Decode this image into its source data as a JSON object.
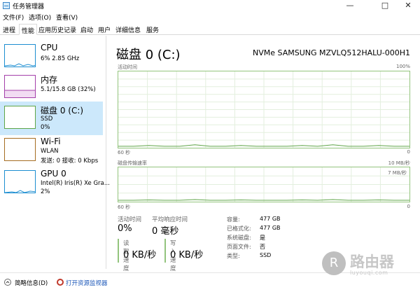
{
  "window": {
    "title": "任务管理器",
    "controls": [
      "—",
      "□",
      "✕"
    ]
  },
  "menu": [
    "文件(F)",
    "选项(O)",
    "查看(V)"
  ],
  "tabs": [
    "进程",
    "性能",
    "应用历史记录",
    "启动",
    "用户",
    "详细信息",
    "服务"
  ],
  "active_tab": "性能",
  "sidebar": [
    {
      "name": "CPU",
      "line1": "6%  2.85 GHz",
      "line2": "",
      "color": "#1d8ed1"
    },
    {
      "name": "内存",
      "line1": "5.1/15.8 GB (32%)",
      "line2": "",
      "color": "#a43faa"
    },
    {
      "name": "磁盘 0 (C:)",
      "line1": "SSD",
      "line2": "0%",
      "color": "#5fa548"
    },
    {
      "name": "Wi-Fi",
      "line1": "WLAN",
      "line2": "发送: 0 接收: 0 Kbps",
      "color": "#a66d22"
    },
    {
      "name": "GPU 0",
      "line1": "Intel(R) Iris(R) Xe Gra...",
      "line2": "2%",
      "color": "#1d8ed1"
    }
  ],
  "disk": {
    "title": "磁盘 0 (C:)",
    "model": "NVMe SAMSUNG MZVLQ512HALU-000H1",
    "graph1": {
      "label": "活动时间",
      "max": "100%",
      "x_left": "60 秒",
      "x_right": "0",
      "values": [
        1,
        1,
        2,
        1,
        1,
        3,
        1,
        1,
        2,
        1,
        1,
        1,
        2,
        1,
        3,
        1,
        1,
        2,
        1,
        1
      ]
    },
    "graph2": {
      "label": "磁盘传输速率",
      "max": "10 MB/秒",
      "scale": "7 MB/秒",
      "x_left": "60 秒",
      "x_right": "0",
      "values": [
        2,
        2,
        3,
        2,
        2,
        4,
        2,
        2,
        3,
        2,
        2,
        2,
        3,
        2,
        4,
        2,
        2,
        3,
        2,
        2
      ]
    },
    "stats": {
      "active_time_label": "活动时间",
      "active_time": "0%",
      "avg_response_label": "平均响应时间",
      "avg_response": "0 毫秒",
      "read_label": "读取速度",
      "read": "0 KB/秒",
      "write_label": "写入速度",
      "write": "0 KB/秒"
    },
    "info": [
      {
        "key": "容量:",
        "value": "477 GB"
      },
      {
        "key": "已格式化:",
        "value": "477 GB"
      },
      {
        "key": "系统磁盘:",
        "value": "是"
      },
      {
        "key": "页面文件:",
        "value": "否"
      },
      {
        "key": "类型:",
        "value": "SSD"
      }
    ]
  },
  "footer": {
    "summary": "简略信息(D)",
    "monitor": "打开资源监视器"
  },
  "watermark": {
    "text": "路由器",
    "sub": "luyouqi.com"
  }
}
